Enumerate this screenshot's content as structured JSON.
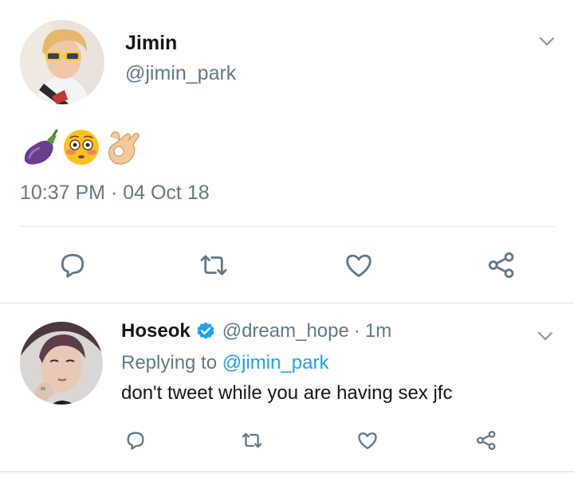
{
  "tweet": {
    "author_name": "Jimin",
    "author_handle": "@jimin_park",
    "emojis": [
      "eggplant-emoji",
      "flushed-face-emoji",
      "ok-hand-emoji"
    ],
    "timestamp": "10:37 PM · 04 Oct 18"
  },
  "reply": {
    "author_name": "Hoseok",
    "verified": true,
    "author_handle": "@dream_hope",
    "separator": "·",
    "time": "1m",
    "replying_prefix": "Replying to ",
    "replying_to": "@jimin_park",
    "text": "don't tweet while you are having sex jfc"
  },
  "icons": {
    "reply": "speech-bubble-icon",
    "retweet": "retweet-icon",
    "like": "heart-icon",
    "share": "share-icon",
    "menu": "chevron-down-icon",
    "verified": "verified-badge-icon"
  },
  "colors": {
    "text": "#14171a",
    "secondary": "#657786",
    "link": "#1da1f2",
    "icon": "#657786",
    "divider": "#e1e8ed"
  }
}
